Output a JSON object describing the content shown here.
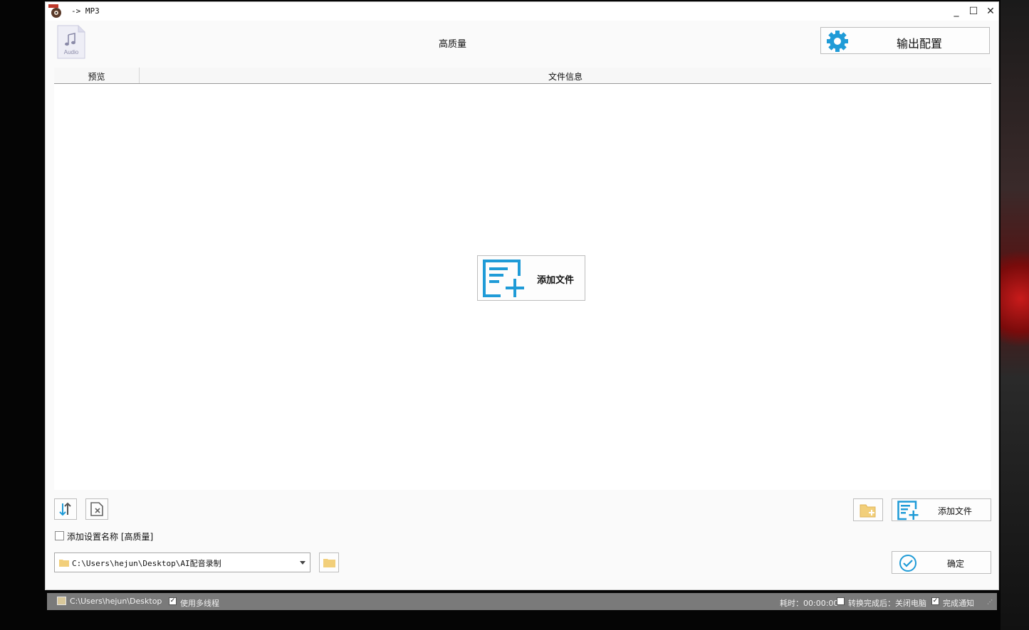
{
  "window": {
    "title": "-> MP3",
    "minimize_glyph": "_",
    "maximize_glyph": "☐",
    "close_glyph": "✕"
  },
  "header": {
    "format_icon_label": "Audio",
    "quality": "高质量",
    "output_config_label": "输出配置"
  },
  "table": {
    "columns": [
      "预览",
      "文件信息"
    ]
  },
  "center_add_label": "添加文件",
  "bottom": {
    "add_file_label": "添加文件",
    "add_setting_name_label": "添加设置名称 [高质量]",
    "add_setting_name_checked": false,
    "output_path": "C:\\Users\\hejun\\Desktop\\AI配音录制",
    "confirm_label": "确定"
  },
  "statusbar": {
    "path": "C:\\Users\\hejun\\Desktop",
    "multithread_label": "使用多线程",
    "multithread_checked": true,
    "elapsed_label": "耗时：00:00:00",
    "after_convert_label": "转换完成后：关闭电脑",
    "after_convert_checked": false,
    "notify_label": "完成通知",
    "notify_checked": true
  },
  "colors": {
    "accent_blue": "#1f9bd7",
    "folder_yellow": "#f2cf7a",
    "statusbar_bg": "#7a7a7a"
  }
}
